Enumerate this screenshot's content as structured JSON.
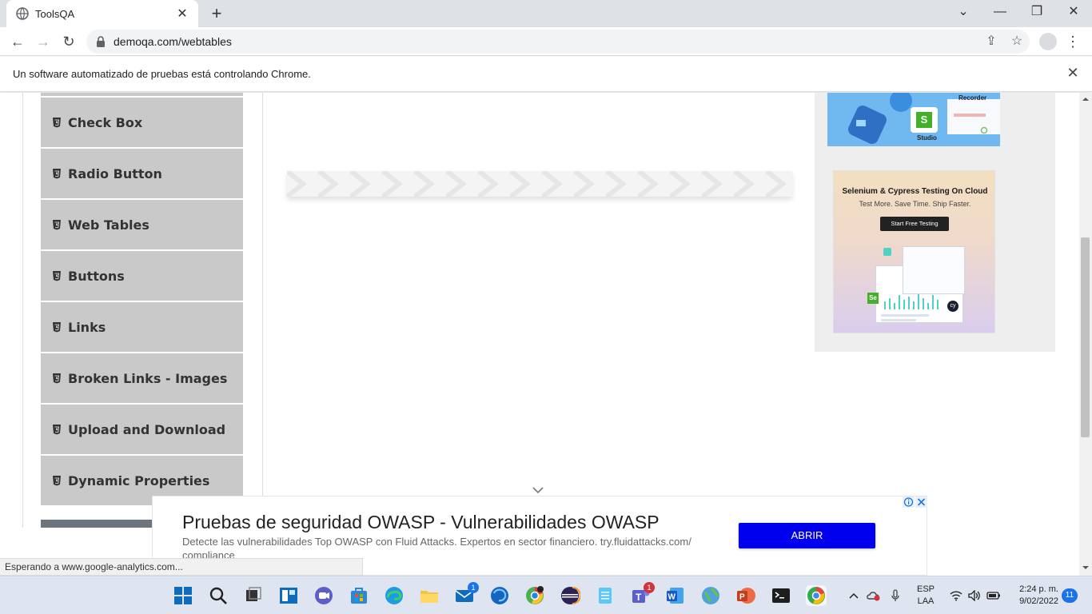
{
  "browser": {
    "tab_title": "ToolsQA",
    "url": "demoqa.com/webtables",
    "automation_message": "Un software automatizado de pruebas está controlando Chrome.",
    "status_text": "Esperando a www.google-analytics.com..."
  },
  "sidebar": {
    "items": [
      {
        "label": "Check Box"
      },
      {
        "label": "Radio Button"
      },
      {
        "label": "Web Tables"
      },
      {
        "label": "Buttons"
      },
      {
        "label": "Links"
      },
      {
        "label": "Broken Links - Images"
      },
      {
        "label": "Upload and Download"
      },
      {
        "label": "Dynamic Properties"
      }
    ]
  },
  "side_ads": {
    "top_banner": {
      "recorder_label": "Recorder",
      "studio_label": "Studio"
    },
    "card": {
      "headline": "Selenium & Cypress Testing On Cloud",
      "subline": "Test More. Save Time. Ship Faster.",
      "cta": "Start Free Testing"
    }
  },
  "bottom_ad": {
    "headline": "Pruebas de seguridad OWASP - Vulnerabilidades OWASP",
    "description": "Detecte las vulnerabilidades Top OWASP con Fluid Attacks. Expertos en sector financiero. try.fluidattacks.com/ compliance",
    "button_label": "ABRIR"
  },
  "taskbar": {
    "mail_badge": "1",
    "teams_badge": "1",
    "language_line1": "ESP",
    "language_line2": "LAA",
    "time": "2:24 p. m.",
    "date": "9/02/2022",
    "notification_count": "11"
  },
  "colors": {
    "sidebar_item_bg": "#c9c9c9",
    "ad_button": "#0000ee",
    "taskbar_bg": "#dee4f0"
  }
}
